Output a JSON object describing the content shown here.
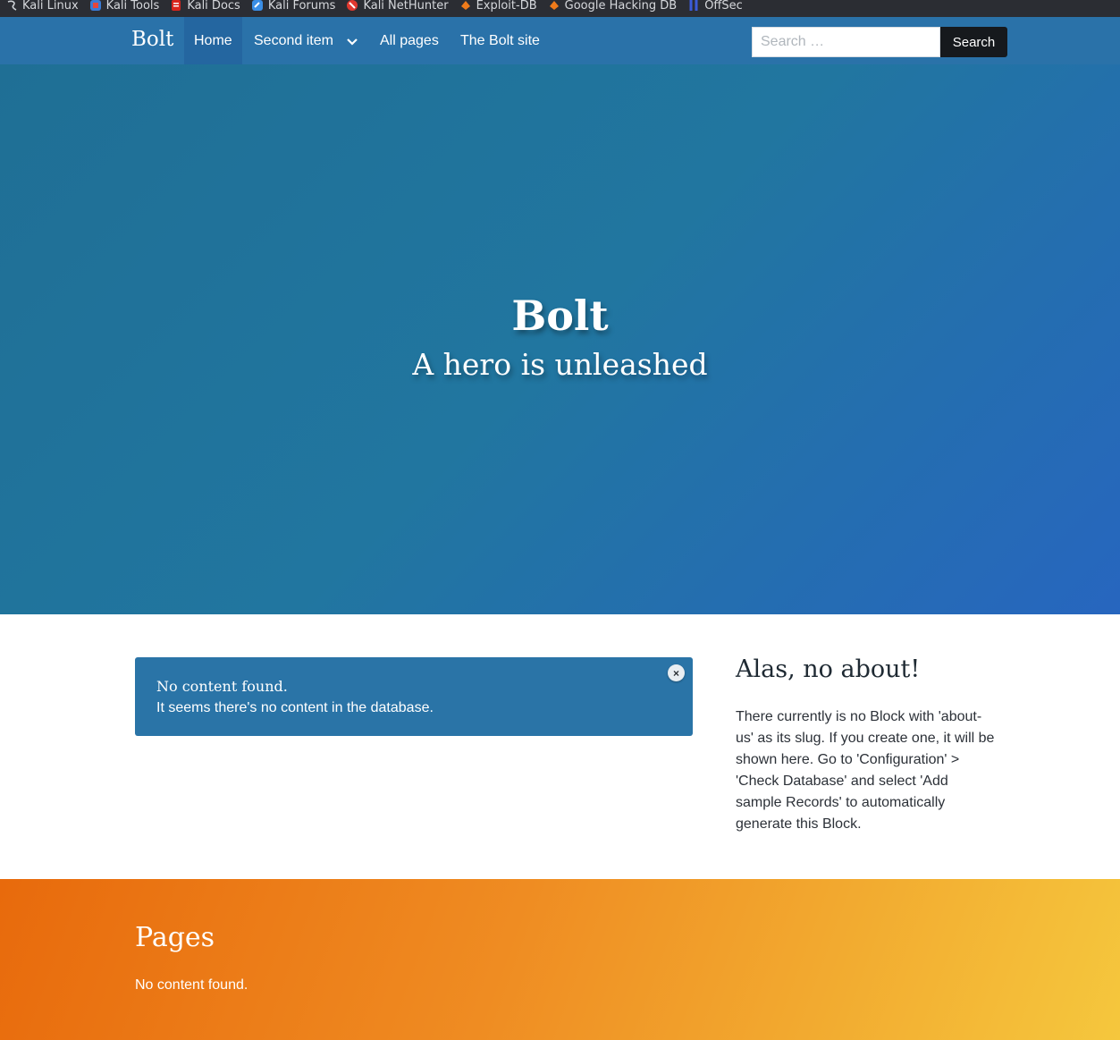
{
  "bookmarks": [
    {
      "label": "Kali Linux",
      "icon": "kali-dragon-icon",
      "color": "#3a7bd5"
    },
    {
      "label": "Kali Tools",
      "icon": "kali-tools-icon",
      "color": "#e6463c"
    },
    {
      "label": "Kali Docs",
      "icon": "kali-docs-icon",
      "color": "#d9251d"
    },
    {
      "label": "Kali Forums",
      "icon": "kali-forums-icon",
      "color": "#3a8ee6"
    },
    {
      "label": "Kali NetHunter",
      "icon": "kali-nethunter-icon",
      "color": "#e0382f"
    },
    {
      "label": "Exploit-DB",
      "icon": "exploit-db-icon",
      "color": "#ef7b1a"
    },
    {
      "label": "Google Hacking DB",
      "icon": "ghdb-icon",
      "color": "#ef7b1a"
    },
    {
      "label": "OffSec",
      "icon": "offsec-icon",
      "color": "#3b5bd9"
    }
  ],
  "navbar": {
    "brand": "Bolt",
    "items": [
      {
        "label": "Home",
        "active": true
      },
      {
        "label": "Second item",
        "has_dropdown": true
      },
      {
        "label": "All pages"
      },
      {
        "label": "The Bolt site"
      }
    ],
    "search_placeholder": "Search …",
    "search_button": "Search"
  },
  "hero": {
    "title": "Bolt",
    "subtitle": "A hero is unleashed"
  },
  "alert": {
    "title": "No content found.",
    "text": "It seems there's no content in the database.",
    "close_symbol": "×"
  },
  "about": {
    "title": "Alas, no about!",
    "text": "There currently is no Block with 'about-us' as its slug. If you create one, it will be shown here. Go to 'Configuration' > 'Check Database' and select 'Add sample Records' to automatically generate this Block."
  },
  "pages": {
    "title": "Pages",
    "text": "No content found."
  },
  "colors": {
    "navbar": "#2a72a9",
    "hero_start": "#1f6f95",
    "hero_end": "#2766bf",
    "pages_start": "#e86a0c",
    "pages_end": "#f5c73d"
  }
}
